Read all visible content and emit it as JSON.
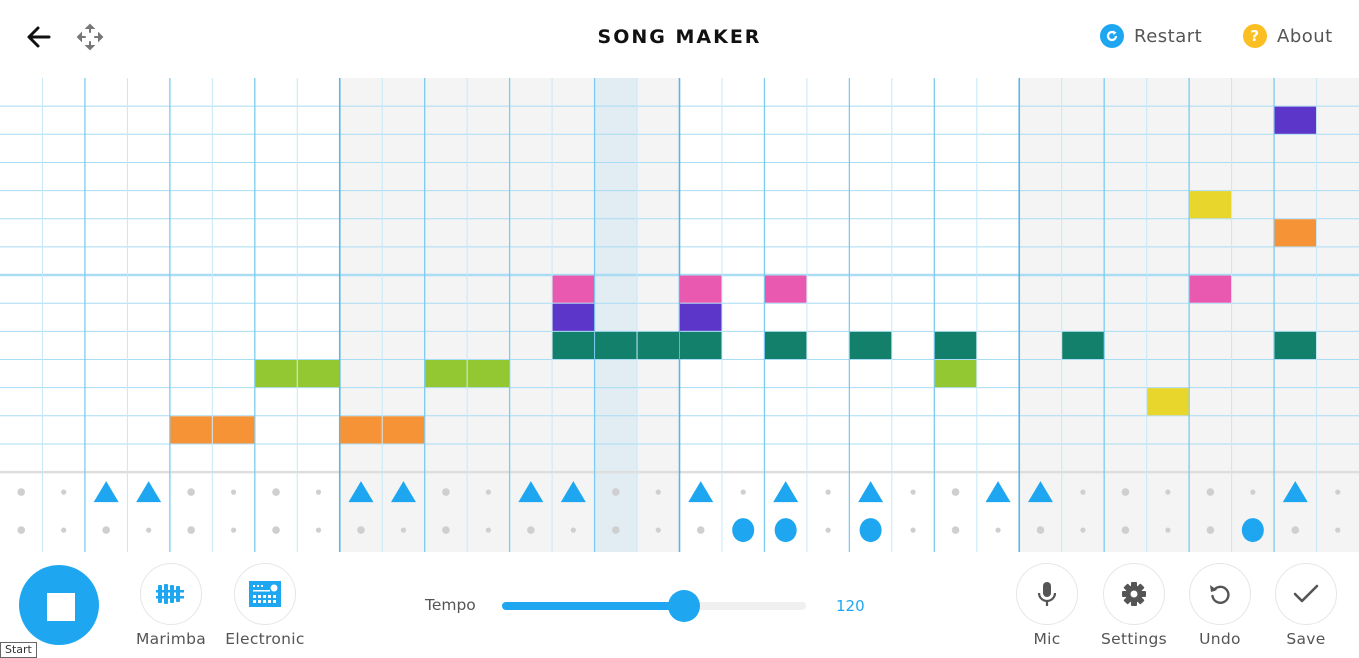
{
  "header": {
    "title": "SONG MAKER",
    "back_icon": "arrow-left-icon",
    "move_icon": "move-arrows-icon",
    "restart": {
      "label": "Restart",
      "icon": "restart-icon",
      "color": "#1ea7f0"
    },
    "about": {
      "label": "About",
      "icon": "question-icon",
      "glyph": "?",
      "color": "#fbbf24"
    }
  },
  "grid": {
    "columns": 32,
    "melody_rows": 14,
    "beats_per_bar": 8,
    "shaded_bars": [
      1,
      3
    ],
    "octave_line_after_row": 6,
    "playhead_column": 14,
    "colors": {
      "purple": "#5c35c9",
      "yellow": "#e8d62c",
      "orange": "#f79337",
      "pink": "#e959b0",
      "teal": "#13806c",
      "green": "#94c832",
      "accent": "#1ea7f0"
    },
    "notes": [
      {
        "col": 30,
        "row": 1,
        "color": "purple"
      },
      {
        "col": 28,
        "row": 4,
        "color": "yellow"
      },
      {
        "col": 30,
        "row": 5,
        "color": "orange"
      },
      {
        "col": 13,
        "row": 7,
        "color": "pink"
      },
      {
        "col": 16,
        "row": 7,
        "color": "pink"
      },
      {
        "col": 18,
        "row": 7,
        "color": "pink"
      },
      {
        "col": 28,
        "row": 7,
        "color": "pink"
      },
      {
        "col": 13,
        "row": 8,
        "color": "purple"
      },
      {
        "col": 16,
        "row": 8,
        "color": "purple"
      },
      {
        "col": 13,
        "row": 9,
        "color": "teal"
      },
      {
        "col": 14,
        "row": 9,
        "color": "teal"
      },
      {
        "col": 15,
        "row": 9,
        "color": "teal"
      },
      {
        "col": 16,
        "row": 9,
        "color": "teal"
      },
      {
        "col": 18,
        "row": 9,
        "color": "teal"
      },
      {
        "col": 20,
        "row": 9,
        "color": "teal"
      },
      {
        "col": 22,
        "row": 9,
        "color": "teal"
      },
      {
        "col": 25,
        "row": 9,
        "color": "teal"
      },
      {
        "col": 30,
        "row": 9,
        "color": "teal"
      },
      {
        "col": 6,
        "row": 10,
        "color": "green"
      },
      {
        "col": 7,
        "row": 10,
        "color": "green"
      },
      {
        "col": 10,
        "row": 10,
        "color": "green"
      },
      {
        "col": 11,
        "row": 10,
        "color": "green"
      },
      {
        "col": 22,
        "row": 10,
        "color": "green"
      },
      {
        "col": 27,
        "row": 11,
        "color": "yellow"
      },
      {
        "col": 4,
        "row": 12,
        "color": "orange"
      },
      {
        "col": 5,
        "row": 12,
        "color": "orange"
      },
      {
        "col": 8,
        "row": 12,
        "color": "orange"
      },
      {
        "col": 9,
        "row": 12,
        "color": "orange"
      }
    ],
    "percussion": {
      "triangles": [
        2,
        3,
        8,
        9,
        12,
        13,
        16,
        18,
        20,
        23,
        24,
        30
      ],
      "circles": [
        17,
        18,
        20,
        29
      ]
    }
  },
  "toolbar": {
    "play_button": {
      "state": "playing",
      "icon": "stop-icon",
      "tooltip": "Start"
    },
    "instruments": [
      {
        "label": "Marimba",
        "icon": "marimba-icon"
      },
      {
        "label": "Electronic",
        "icon": "drum-machine-icon"
      }
    ],
    "tempo": {
      "label": "Tempo",
      "value": "120",
      "fraction": 0.6
    },
    "actions": [
      {
        "label": "Mic",
        "icon": "microphone-icon"
      },
      {
        "label": "Settings",
        "icon": "gear-icon"
      },
      {
        "label": "Undo",
        "icon": "undo-icon"
      },
      {
        "label": "Save",
        "icon": "checkmark-icon"
      }
    ]
  }
}
